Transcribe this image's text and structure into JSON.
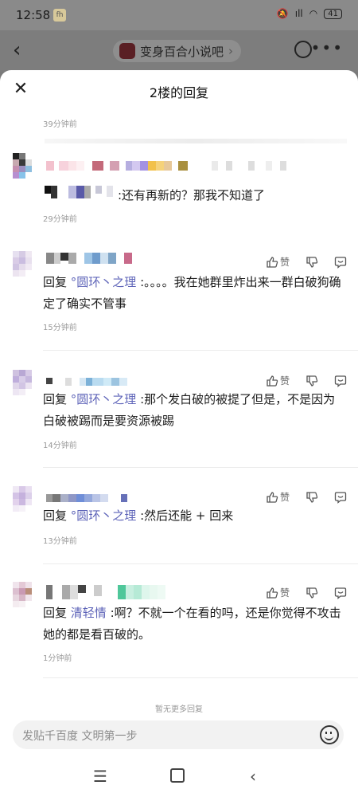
{
  "status_bar": {
    "time": "12:58",
    "app_icon": "fh",
    "signal_text": "ıll",
    "battery": "41"
  },
  "app_bar": {
    "forum_name": "变身百合小说吧"
  },
  "sheet": {
    "title": "2楼的回复",
    "top_time": "39分钟前"
  },
  "comments": [
    {
      "text": ":还有再新的？那我不知道了",
      "time": "29分钟前"
    },
    {
      "reply_label": "回复",
      "reply_to": "°圆环丶之理",
      "text": ":。。。。我在她群里炸出来一群白破狗确定了确实不管事",
      "time": "15分钟前",
      "like_label": "赞"
    },
    {
      "reply_label": "回复",
      "reply_to": "°圆环丶之理",
      "text": ":那个发白破的被提了但是，不是因为白破被踢而是要资源被踢",
      "time": "14分钟前",
      "like_label": "赞"
    },
    {
      "reply_label": "回复",
      "reply_to": "°圆环丶之理",
      "text": ":然后还能 + 回来",
      "time": "13分钟前",
      "like_label": "赞"
    },
    {
      "reply_label": "回复",
      "reply_to": "清轻情",
      "text": ":啊？不就一个在看的吗，还是你觉得不攻击她的都是看百破的。",
      "time": "1分钟前",
      "like_label": "赞"
    }
  ],
  "footer": {
    "no_more": "暂无更多回复",
    "input_placeholder": "发贴千百度 文明第一步"
  },
  "colors": {
    "reply_to": "#5d63b8",
    "sheet_bg": "#ffffff",
    "overlay": "#7a7a7a"
  }
}
